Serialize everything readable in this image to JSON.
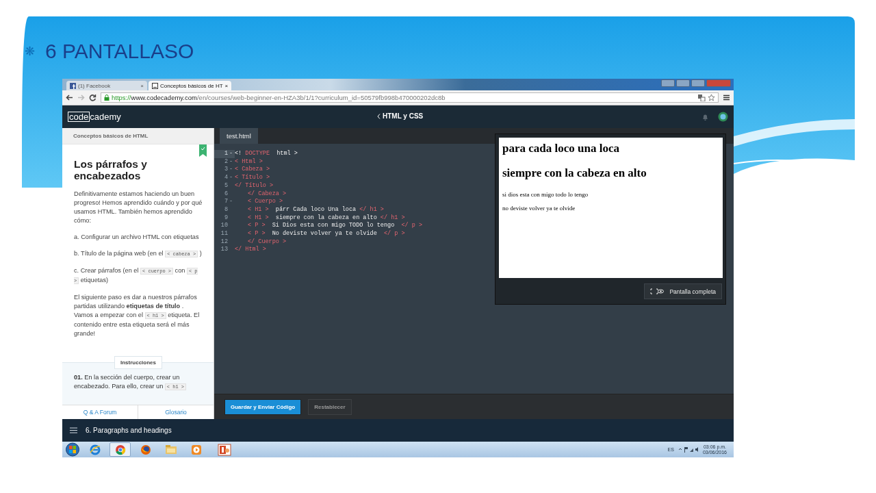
{
  "slide": {
    "bullet": "❋",
    "title": "6 PANTALLASO"
  },
  "browser": {
    "tabs": [
      {
        "kind": "facebook",
        "label": "(1) Facebook",
        "close": "×",
        "selected": false
      },
      {
        "kind": "page",
        "label": "Conceptos básicos de HT",
        "close": "×",
        "selected": true
      }
    ],
    "url": {
      "scheme": "https://",
      "host": "www.codecademy.com",
      "path": "/en/courses/web-beginner-en-HZA3b/1/1?curriculum_id=50579fb998b470000202dc8b"
    }
  },
  "header": {
    "logo": [
      "code",
      "cademy"
    ],
    "course": "HTML y CSS"
  },
  "sidebar": {
    "section": "Conceptos básicos de HTML",
    "title": "Los párrafos y encabezados",
    "completed": true,
    "paragraphs": [
      [
        {
          "kind": "text",
          "text": "Definitivamente estamos haciendo un buen progreso! Hemos aprendido cuándo y por qué usamos HTML. También hemos aprendido cómo:"
        }
      ],
      [
        {
          "kind": "text",
          "text": "a. Configurar un archivo HTML con etiquetas"
        }
      ],
      [
        {
          "kind": "text",
          "text": "b. Título de la página web (en el "
        },
        {
          "kind": "code",
          "text": "< cabeza >"
        },
        {
          "kind": "text",
          "text": " )"
        }
      ],
      [
        {
          "kind": "text",
          "text": "c. Crear párrafos (en el "
        },
        {
          "kind": "code",
          "text": "< cuerpo >"
        },
        {
          "kind": "text",
          "text": " con "
        },
        {
          "kind": "code",
          "text": "< p >"
        },
        {
          "kind": "text",
          "text": " etiquetas)"
        }
      ],
      [
        {
          "kind": "text",
          "text": "El siguiente paso es dar a nuestros párrafos partidas utilizando **etiquetas de título** . Vamos a empezar con el "
        },
        {
          "kind": "code",
          "text": "< h1 >"
        },
        {
          "kind": "text",
          "text": " etiqueta. El contenido entre esta etiqueta será el más grande!"
        }
      ]
    ],
    "instructions_label": "Instrucciones",
    "instruction": [
      {
        "kind": "text",
        "text": "**01.** En la sección del cuerpo, crear un encabezado. Para ello, crear un "
      },
      {
        "kind": "code",
        "text": "< h1 >"
      }
    ],
    "links": [
      "Q & A Forum",
      "Glosario"
    ]
  },
  "editor": {
    "file_tab": "test.html",
    "lines": [
      {
        "number": "1",
        "fold": "-",
        "indented": false,
        "tokens": [
          {
            "kind": "text",
            "text": "<!"
          },
          {
            "kind": "tag",
            "text": " DOCTYPE"
          },
          {
            "kind": "text",
            "text": "  html >"
          }
        ]
      },
      {
        "number": "2",
        "fold": "-",
        "indented": false,
        "tokens": [
          {
            "kind": "tag",
            "text": "< Html >"
          }
        ]
      },
      {
        "number": "3",
        "fold": "-",
        "indented": false,
        "tokens": [
          {
            "kind": "tag",
            "text": "< Cabeza >"
          }
        ]
      },
      {
        "number": "4",
        "fold": "-",
        "indented": false,
        "tokens": [
          {
            "kind": "tag",
            "text": "< Título >"
          }
        ]
      },
      {
        "number": "5",
        "indented": false,
        "tokens": [
          {
            "kind": "tag",
            "text": "</ Título >"
          }
        ]
      },
      {
        "number": "6",
        "indented": true,
        "tokens": [
          {
            "kind": "tag",
            "text": "</ Cabeza >"
          }
        ]
      },
      {
        "number": "7",
        "fold": "-",
        "indented": true,
        "tokens": [
          {
            "kind": "tag",
            "text": "< Cuerpo >"
          }
        ]
      },
      {
        "number": "8",
        "indented": true,
        "tokens": [
          {
            "kind": "tag",
            "text": "< H1 >"
          },
          {
            "kind": "text",
            "text": "  párr Cada loco Una loca "
          },
          {
            "kind": "tag",
            "text": "</ h1 >"
          }
        ]
      },
      {
        "number": "9",
        "indented": true,
        "tokens": [
          {
            "kind": "tag",
            "text": "< H1 >"
          },
          {
            "kind": "text",
            "text": "  siempre con la cabeza en alto "
          },
          {
            "kind": "tag",
            "text": "</ h1 >"
          }
        ]
      },
      {
        "number": "10",
        "indented": true,
        "tokens": [
          {
            "kind": "tag",
            "text": "< P >"
          },
          {
            "kind": "text",
            "text": "  Si Dios esta con migo TODO lo tengo  "
          },
          {
            "kind": "tag",
            "text": "</ p >"
          }
        ]
      },
      {
        "number": "11",
        "indented": true,
        "tokens": [
          {
            "kind": "tag",
            "text": "< P >"
          },
          {
            "kind": "text",
            "text": "  No deviste volver ya te olvide  "
          },
          {
            "kind": "tag",
            "text": "</ p >"
          }
        ]
      },
      {
        "number": "12",
        "indented": true,
        "tokens": [
          {
            "kind": "tag",
            "text": "</ Cuerpo >"
          }
        ]
      },
      {
        "number": "13",
        "indented": false,
        "tokens": [
          {
            "kind": "tag",
            "text": "</ Html >"
          }
        ]
      }
    ],
    "buttons": [
      {
        "kind": "primary",
        "label": "Guardar y Enviar Código"
      },
      {
        "kind": "secondary",
        "label": "Restablecer"
      }
    ]
  },
  "preview": {
    "content": [
      {
        "kind": "h1",
        "text": "para cada loco una loca"
      },
      {
        "kind": "h1",
        "text": "siempre con la cabeza en alto"
      },
      {
        "kind": "p",
        "text": "si dios esta con migo todo lo tengo"
      },
      {
        "kind": "p",
        "text": "no deviste volver ya te olvide"
      }
    ],
    "fullscreen": "Pantalla completa"
  },
  "footer": {
    "lesson": "6. Paragraphs and headings"
  },
  "taskbar": {
    "apps": [
      {
        "kind": "ie",
        "selected": false
      },
      {
        "kind": "chrome",
        "selected": true
      },
      {
        "kind": "firefox",
        "selected": false
      },
      {
        "kind": "folder",
        "selected": false
      },
      {
        "kind": "media",
        "selected": false
      },
      {
        "kind": "powerpoint",
        "selected": false
      }
    ],
    "language": "ES",
    "time": "03:06 p.m.",
    "date": "03/06/2016"
  }
}
